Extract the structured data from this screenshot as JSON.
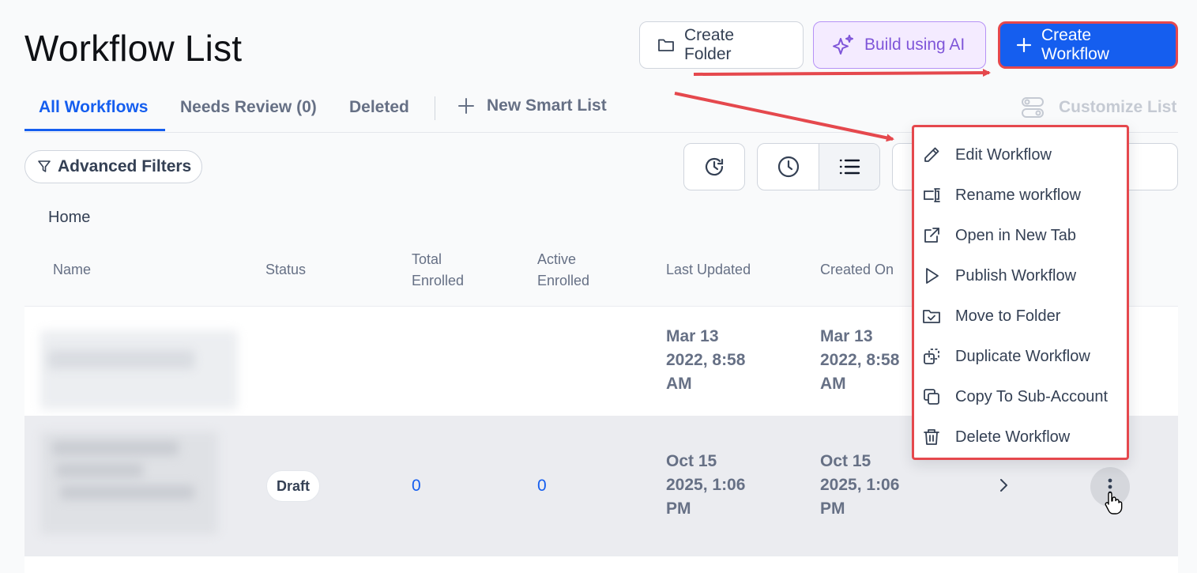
{
  "page": {
    "title": "Workflow List"
  },
  "header": {
    "create_folder_label": "Create Folder",
    "build_ai_label": "Build using AI",
    "create_workflow_label": "Create Workflow"
  },
  "tabs": [
    {
      "label": "All Workflows",
      "active": true
    },
    {
      "label": "Needs Review (0)",
      "active": false
    },
    {
      "label": "Deleted",
      "active": false
    }
  ],
  "new_smart_list_label": "New Smart List",
  "customize_list_label": "Customize List",
  "filters": {
    "advanced_label": "Advanced Filters"
  },
  "breadcrumb": {
    "home": "Home"
  },
  "table": {
    "columns": [
      "Name",
      "Status",
      "Total Enrolled",
      "Active Enrolled",
      "Last Updated",
      "Created On"
    ],
    "column_lines": {
      "name": [
        "Name"
      ],
      "status": [
        "Status"
      ],
      "total": [
        "Total",
        "Enrolled"
      ],
      "active": [
        "Active",
        "Enrolled"
      ],
      "last_updated": [
        "Last Updated"
      ],
      "created_on": [
        "Created On"
      ]
    },
    "rows": [
      {
        "status": "",
        "total": "",
        "active": "",
        "last_updated": [
          "Mar 13",
          "2022, 8:58",
          "AM"
        ],
        "created_on": [
          "Mar 13",
          "2022, 8:58",
          "AM"
        ]
      },
      {
        "status": "Draft",
        "total": "0",
        "active": "0",
        "last_updated": [
          "Oct 15",
          "2025, 1:06",
          "PM"
        ],
        "created_on": [
          "Oct 15",
          "2025, 1:06",
          "PM"
        ]
      }
    ]
  },
  "menu": {
    "items": [
      {
        "label": "Edit Workflow",
        "icon": "pencil-icon"
      },
      {
        "label": "Rename workflow",
        "icon": "rename-icon"
      },
      {
        "label": "Open in New Tab",
        "icon": "external-link-icon"
      },
      {
        "label": "Publish Workflow",
        "icon": "play-icon"
      },
      {
        "label": "Move to Folder",
        "icon": "folder-check-icon"
      },
      {
        "label": "Duplicate Workflow",
        "icon": "duplicate-icon"
      },
      {
        "label": "Copy To Sub-Account",
        "icon": "copy-icon"
      },
      {
        "label": "Delete Workflow",
        "icon": "trash-icon"
      }
    ]
  },
  "colors": {
    "primary": "#155eef",
    "ai_purple": "#7f56d9",
    "annotation_red": "#e5484d"
  }
}
